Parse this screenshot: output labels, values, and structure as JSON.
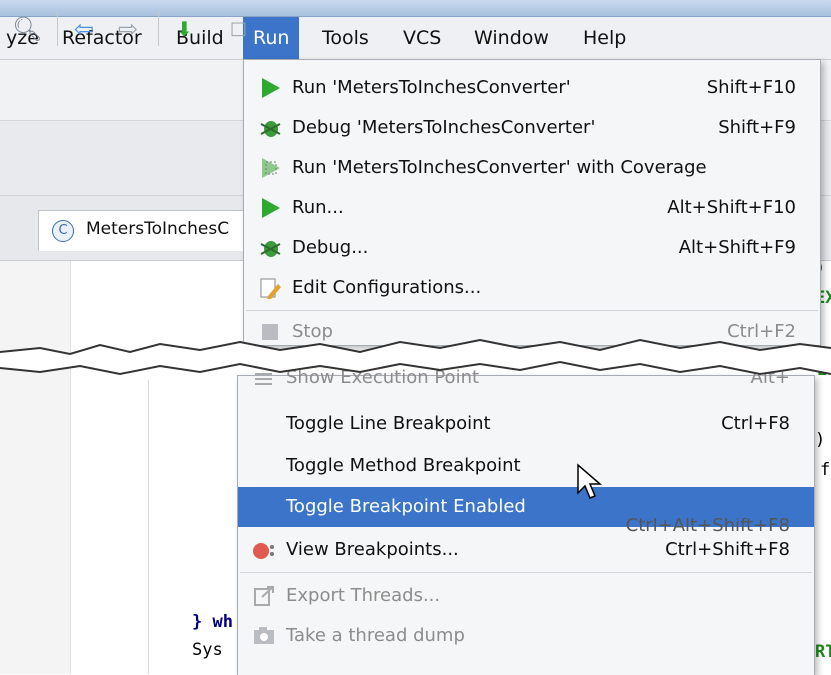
{
  "menubar": {
    "items": [
      {
        "label": "yze"
      },
      {
        "label": "Refactor"
      },
      {
        "label": "Build"
      },
      {
        "label": "Run"
      },
      {
        "label": "Tools"
      },
      {
        "label": "VCS"
      },
      {
        "label": "Window"
      },
      {
        "label": "Help"
      }
    ]
  },
  "editor": {
    "tab_badge": "C",
    "tab_label": "MetersToInchesC",
    "code_fragments": [
      "} wh",
      "Sys",
      ")",
      "EX",
      "E",
      ") =",
      "f",
      "RT"
    ]
  },
  "run_menu": {
    "items": [
      {
        "label": "Run 'MetersToInchesConverter'",
        "shortcut": "Shift+F10",
        "icon": "run-icon"
      },
      {
        "label": "Debug 'MetersToInchesConverter'",
        "shortcut": "Shift+F9",
        "icon": "debug-icon"
      },
      {
        "label": "Run 'MetersToInchesConverter' with Coverage",
        "shortcut": "",
        "icon": "coverage-icon"
      },
      {
        "label": "Run...",
        "shortcut": "Alt+Shift+F10",
        "icon": "run-icon"
      },
      {
        "label": "Debug...",
        "shortcut": "Alt+Shift+F9",
        "icon": "debug-icon"
      },
      {
        "label": "Edit Configurations...",
        "shortcut": "",
        "icon": "edit-config-icon"
      },
      {
        "label": "Stop",
        "shortcut": "Ctrl+F2",
        "icon": "stop-icon",
        "disabled": true
      }
    ],
    "lower_items": [
      {
        "label": "Show Execution Point",
        "shortcut": "Alt+",
        "icon": "execution-point-icon",
        "disabled": true
      },
      {
        "label": "Toggle Line Breakpoint",
        "shortcut": "Ctrl+F8"
      },
      {
        "label": "Toggle Method Breakpoint",
        "shortcut": ""
      },
      {
        "label": "Toggle Breakpoint Enabled",
        "shortcut": "",
        "selected": true
      },
      {
        "label": "",
        "shortcut": "Ctrl+Alt+Shift+F8",
        "partial": true
      },
      {
        "label": "View Breakpoints...",
        "shortcut": "Ctrl+Shift+F8",
        "icon": "breakpoints-icon"
      },
      {
        "label": "Export Threads...",
        "shortcut": "",
        "icon": "export-icon",
        "disabled": true
      },
      {
        "label": "Take a thread dump",
        "shortcut": "",
        "icon": "camera-icon",
        "disabled": true
      }
    ]
  },
  "colors": {
    "selection": "#3b74c9",
    "run_green": "#2fa82f",
    "breakpoint_red": "#e05a4f"
  }
}
